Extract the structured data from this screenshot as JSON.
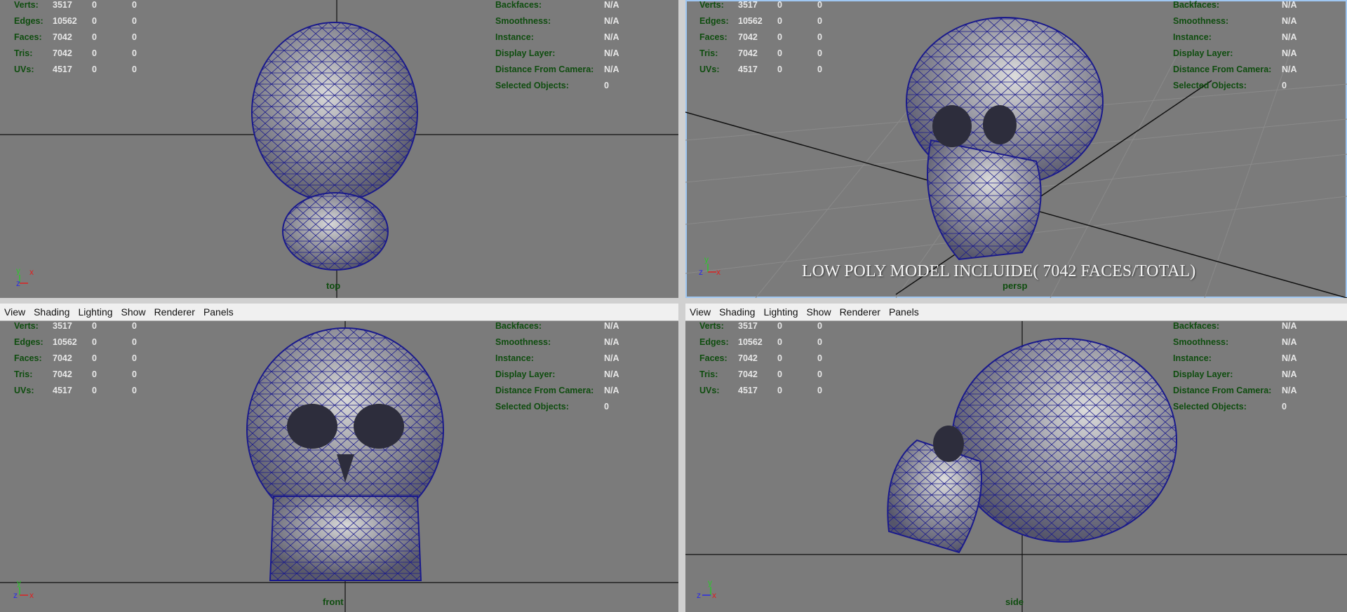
{
  "menu": [
    "View",
    "Shading",
    "Lighting",
    "Show",
    "Renderer",
    "Panels"
  ],
  "hud_left": {
    "rows": [
      {
        "label": "Verts:",
        "v1": "3517",
        "v2": "0",
        "v3": "0"
      },
      {
        "label": "Edges:",
        "v1": "10562",
        "v2": "0",
        "v3": "0"
      },
      {
        "label": "Faces:",
        "v1": "7042",
        "v2": "0",
        "v3": "0"
      },
      {
        "label": "Tris:",
        "v1": "7042",
        "v2": "0",
        "v3": "0"
      },
      {
        "label": "UVs:",
        "v1": "4517",
        "v2": "0",
        "v3": "0"
      }
    ]
  },
  "hud_right": {
    "rows": [
      {
        "label": "Backfaces:",
        "value": "N/A"
      },
      {
        "label": "Smoothness:",
        "value": "N/A"
      },
      {
        "label": "Instance:",
        "value": "N/A"
      },
      {
        "label": "Display Layer:",
        "value": "N/A"
      },
      {
        "label": "Distance From Camera:",
        "value": "N/A"
      },
      {
        "label": "Selected Objects:",
        "value": "0"
      }
    ]
  },
  "viewports": {
    "top": {
      "camera": "top"
    },
    "persp": {
      "camera": "persp",
      "overlay": "LOW POLY MODEL INCLUIDE( 7042 FACES/TOTAL)"
    },
    "front": {
      "camera": "front"
    },
    "side": {
      "camera": "side"
    }
  },
  "axes": {
    "x": "x",
    "y": "y",
    "z": "z"
  },
  "colors": {
    "viewport_bg": "#7b7b7b",
    "wire": "#1a1a8c",
    "hud_label": "#0f4d0f",
    "active_border": "#9fc7f2"
  }
}
